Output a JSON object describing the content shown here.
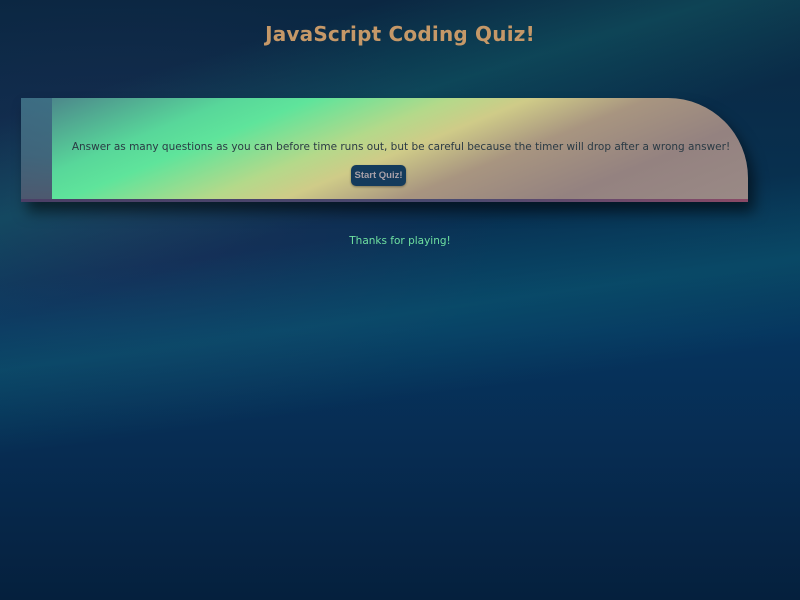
{
  "header": {
    "title": "JavaScript Coding Quiz!"
  },
  "intro_card": {
    "description": "Answer as many questions as you can before time runs out, but be careful because the timer will drop after a wrong answer!",
    "start_button_label": "Start Quiz!"
  },
  "footer": {
    "message": "Thanks for playing!"
  },
  "colors": {
    "title": "#c59868",
    "footer_text": "#6fe0a0",
    "button_bg": "#143b5c",
    "button_text": "#a7a0a8",
    "background": "#06345e"
  }
}
